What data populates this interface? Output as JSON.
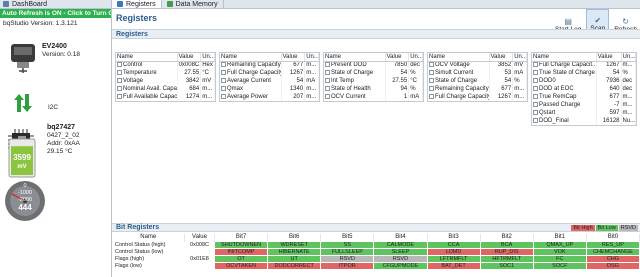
{
  "dashboard": {
    "tab_label": "DashBoard",
    "auto_refresh_text": "Auto Refresh is ON - Click to Turn Off",
    "version_text": "bqStudio Version:  1.3.121",
    "ev": {
      "name": "EV2400",
      "version": "Version: 0.18"
    },
    "bus_label": "I2C",
    "gauge": {
      "name": "bq27427",
      "fw": "0427_2_02",
      "addr": "Addr: 0xAA",
      "temp": "29.15 °C"
    },
    "battery": {
      "value": "3599",
      "unit": "mV",
      "level_fraction": 0.9
    },
    "dial": {
      "value": "444",
      "label1": "-1000",
      "label2": "-2000",
      "label3": "0"
    }
  },
  "tabs": [
    {
      "label": "Registers"
    },
    {
      "label": "Data Memory"
    }
  ],
  "main": {
    "title": "Registers",
    "section_registers": "Registers",
    "section_bit": "Bit Registers",
    "toolbar": {
      "start_log": "Start Log",
      "scan": "Scan",
      "refresh": "Refresh"
    }
  },
  "reg_header": {
    "name": "Name",
    "value": "Value",
    "unit": "Un..."
  },
  "register_tables": [
    {
      "rows": [
        [
          "Control",
          "0x008C",
          "Hex"
        ],
        [
          "Temperature",
          "27.55",
          "°C"
        ],
        [
          "Voltage",
          "3842",
          "mV"
        ],
        [
          "Nominal Avail. Capa...",
          "684",
          "m..."
        ],
        [
          "Full Available Capac...",
          "1274",
          "m..."
        ]
      ]
    },
    {
      "rows": [
        [
          "Remaining Capacity",
          "677",
          "m..."
        ],
        [
          "Full Charge Capacity",
          "1267",
          "m..."
        ],
        [
          "Average Current",
          "54",
          "mA"
        ],
        [
          "Qmax",
          "1340",
          "m..."
        ],
        [
          "Average Power",
          "207",
          "m..."
        ]
      ]
    },
    {
      "rows": [
        [
          "Present DOD",
          "7850",
          "dec"
        ],
        [
          "State of Charge",
          "54",
          "%"
        ],
        [
          "Int Temp",
          "27.55",
          "°C"
        ],
        [
          "State of Health",
          "94",
          "%"
        ],
        [
          "OCV Current",
          "1",
          "mA"
        ]
      ]
    },
    {
      "rows": [
        [
          "OCV Voltage",
          "3852",
          "mV"
        ],
        [
          "Simult Current",
          "53",
          "mA"
        ],
        [
          "State of Charge",
          "54",
          "%"
        ],
        [
          "Remaining Capacity",
          "677",
          "m..."
        ],
        [
          "Full Charge Capacity",
          "1267",
          "m..."
        ]
      ]
    },
    {
      "rows": [
        [
          "Full Charge Capacit...",
          "1267",
          "m..."
        ],
        [
          "True State of Charge",
          "54",
          "%"
        ],
        [
          "DOD0",
          "7936",
          "dec"
        ],
        [
          "DOD at EOC",
          "640",
          "dec"
        ],
        [
          "True RemCap",
          "677",
          "m..."
        ],
        [
          "Passed Charge",
          "-7",
          "m..."
        ],
        [
          "Qstart",
          "597",
          "m..."
        ],
        [
          "DOD_Final",
          "16128",
          "Nu..."
        ]
      ]
    }
  ],
  "bit_registers": {
    "legend": [
      "Bit High",
      "Bit Low",
      "RSVD"
    ],
    "headers": [
      "Name",
      "Value",
      "Bit7",
      "Bit6",
      "Bit5",
      "Bit4",
      "Bit3",
      "Bit2",
      "Bit1",
      "Bit0"
    ],
    "rows": [
      {
        "name": "Control Status (high)",
        "value": "0x008C",
        "bits": [
          [
            "SHUTDOWNEN",
            "lo"
          ],
          [
            "WDRESET",
            "lo"
          ],
          [
            "SS",
            "lo"
          ],
          [
            "CALMODE",
            "lo"
          ],
          [
            "CCA",
            "lo"
          ],
          [
            "BCA",
            "lo"
          ],
          [
            "QMAX_UP",
            "lo"
          ],
          [
            "RES_UP",
            "lo"
          ]
        ]
      },
      {
        "name": "Control Status (low)",
        "value": "",
        "bits": [
          [
            "INITCOMP",
            "hi"
          ],
          [
            "HIBERNATE",
            "lo"
          ],
          [
            "FULLSLEEP",
            "lo"
          ],
          [
            "SLEEP",
            "lo"
          ],
          [
            "LDMD",
            "hi"
          ],
          [
            "RUP_DIS",
            "hi"
          ],
          [
            "VOK",
            "lo"
          ],
          [
            "CHEMCHANGE",
            "lo"
          ]
        ]
      },
      {
        "name": "Flags (high)",
        "value": "0x01E8",
        "bits": [
          [
            "OT",
            "lo"
          ],
          [
            "UT",
            "lo"
          ],
          [
            "RSVD",
            "rs"
          ],
          [
            "RSVD",
            "rs"
          ],
          [
            "LFTRMFLT",
            "lo"
          ],
          [
            "HFTRMFLT",
            "lo"
          ],
          [
            "FC",
            "lo"
          ],
          [
            "CHG",
            "hi"
          ]
        ]
      },
      {
        "name": "Flags (low)",
        "value": "",
        "bits": [
          [
            "OCVTAKEN",
            "hi"
          ],
          [
            "DODCORRECT",
            "hi"
          ],
          [
            "ITPOR",
            "hi"
          ],
          [
            "CFGUPMODE",
            "lo"
          ],
          [
            "BAT_DET",
            "hi"
          ],
          [
            "SOC1",
            "lo"
          ],
          [
            "SOCF",
            "lo"
          ],
          [
            "DSG",
            "hi"
          ]
        ]
      }
    ]
  },
  "colors": {
    "bit_high": "#e06666",
    "bit_low": "#5fc35f",
    "rsvd": "#b8b8b8",
    "accent": "#2d5b8d",
    "banner": "#2bb24c"
  }
}
